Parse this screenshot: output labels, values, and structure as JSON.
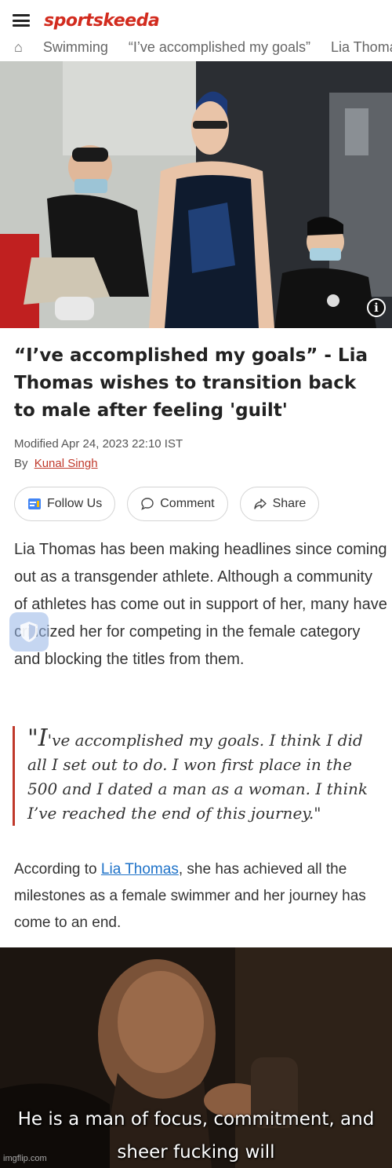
{
  "header": {
    "logo": "sportskeeda"
  },
  "breadcrumb": {
    "items": [
      "Swimming",
      "“I’ve accomplished my goals”",
      "Lia Thomas"
    ]
  },
  "hero": {
    "info_symbol": "i"
  },
  "article": {
    "title": "“I’ve accomplished my goals” - Lia Thomas wishes to transition back to male after feeling 'guilt'",
    "modified": "Modified Apr 24, 2023 22:10 IST",
    "by_label": "By",
    "author": "Kunal Singh",
    "actions": {
      "follow": "Follow Us",
      "comment": "Comment",
      "share": "Share"
    },
    "paragraph1": "Lia Thomas has been making headlines since coming out as a transgender athlete. Although a community of athletes has come out in support of her, many have criticized her for competing in the female category and blocking the titles from them.",
    "quote_open": "\"I",
    "quote_rest": "'ve accomplished my goals. I think I did all I set out to do. I won first place in the 500 and I dated a man as a woman. I think I’ve reached the end of this journey.\"",
    "p2_before": "According to ",
    "p2_link": "Lia Thomas",
    "p2_after": ", she has achieved all the milestones as a female swimmer and her journey has come to an end."
  },
  "meme": {
    "caption_line1": "He is a man of focus, commitment, and",
    "caption_line2": "sheer fucking will",
    "watermark": "imgflip.com"
  },
  "colors": {
    "brand": "#d22b1e",
    "link": "#1e72c8",
    "quote_border": "#c0392b"
  }
}
